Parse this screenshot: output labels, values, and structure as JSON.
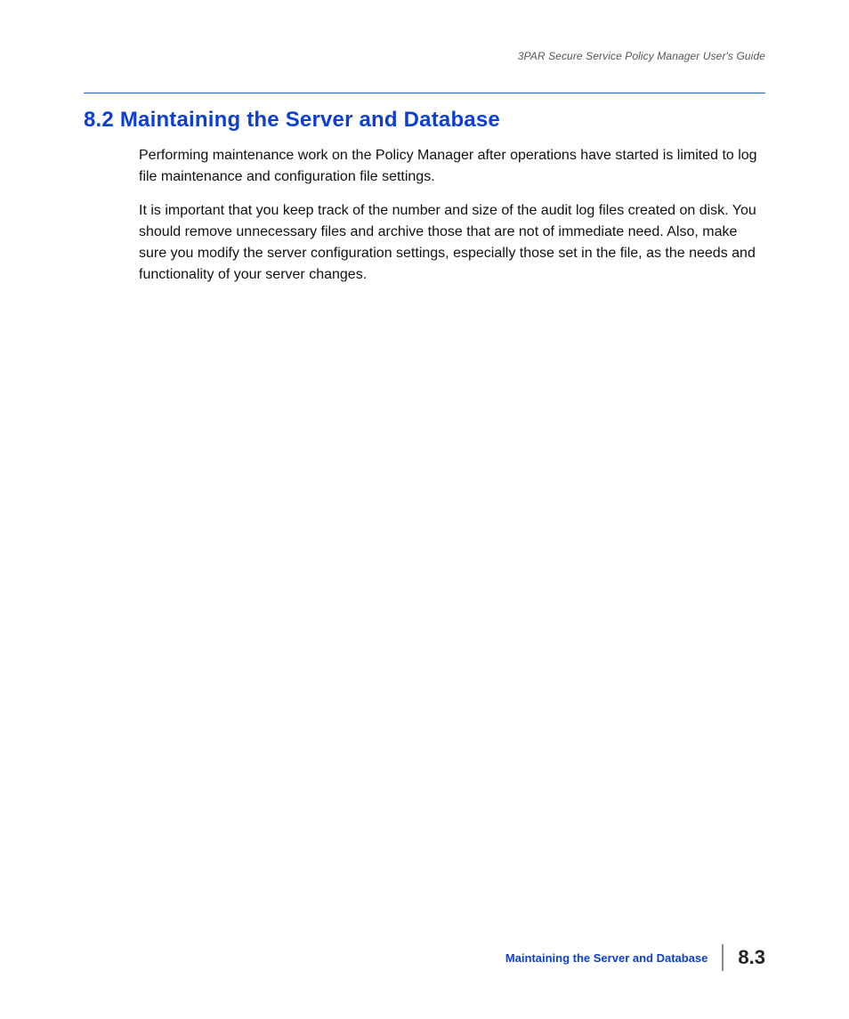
{
  "header": {
    "running_title": "3PAR Secure Service Policy Manager User's Guide"
  },
  "section": {
    "heading": "8.2  Maintaining the Server and Database",
    "paragraphs": [
      "Performing maintenance work on the Policy Manager after operations have started is limited to log file maintenance and configuration file settings.",
      "It is important that you keep track of the number and size of the audit log files created on disk. You should remove unnecessary files and archive those that are not of immediate need. Also, make sure you modify the server configuration settings, especially those set in the                                                    file, as the needs and functionality of your server changes."
    ]
  },
  "footer": {
    "section_title": "Maintaining the Server and Database",
    "page_number": "8.3"
  }
}
